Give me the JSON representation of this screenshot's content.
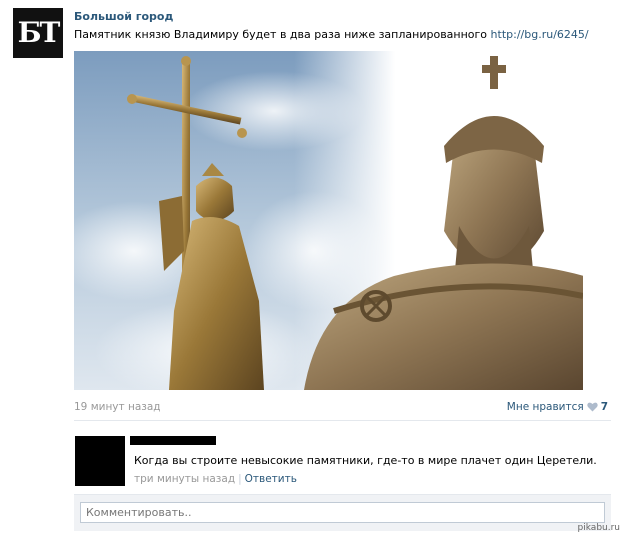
{
  "post": {
    "avatar_text": "БТ",
    "author": "Большой город",
    "text": "Памятник князю Владимиру будет в два раза ниже запланированного",
    "link": "http://bg.ru/6245/",
    "time": "19 минут назад",
    "like_label": "Мне нравится",
    "like_count": "7"
  },
  "comment": {
    "text": "Когда вы строите невысокие памятники, где-то в мире плачет один Церетели.",
    "time": "три минуты назад",
    "reply": "Ответить"
  },
  "reply_box": {
    "placeholder": "Комментировать.."
  },
  "watermark": "pikabu.ru",
  "colors": {
    "link": "#2b587a",
    "muted": "#999999",
    "bronze": "#a88a4e"
  }
}
